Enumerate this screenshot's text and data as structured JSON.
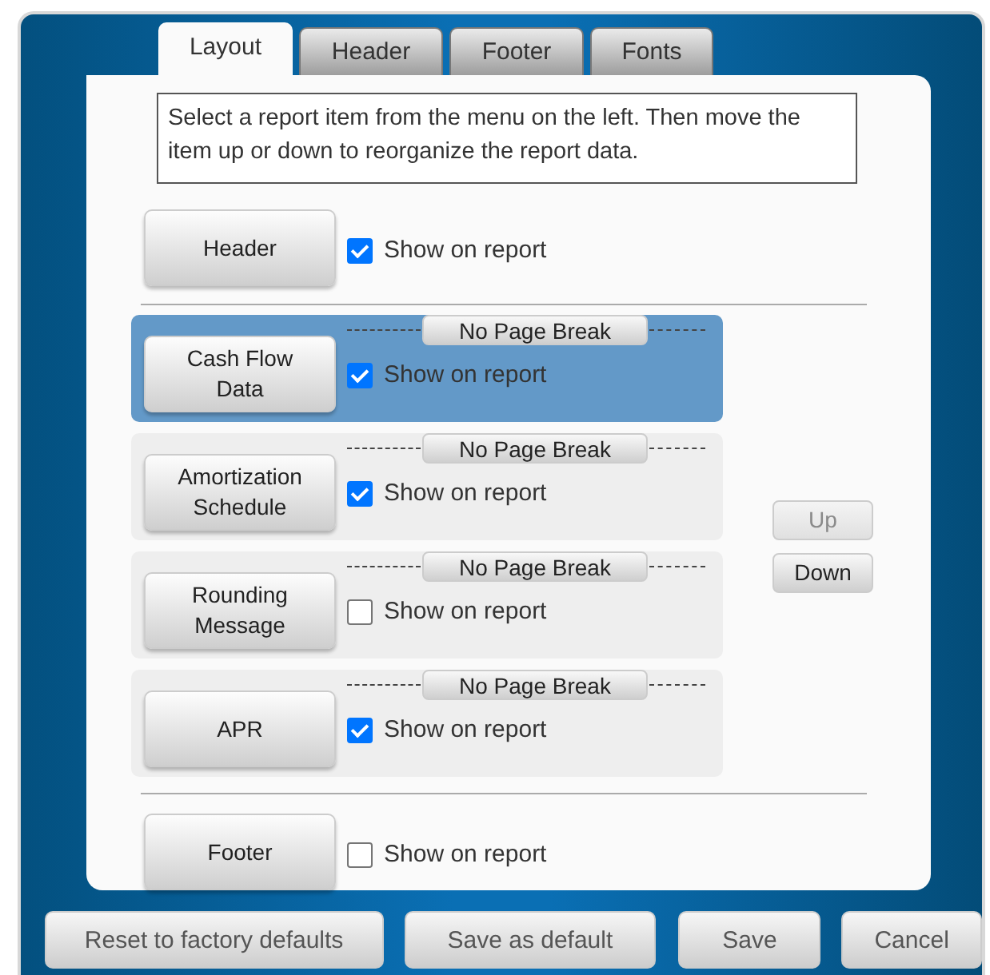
{
  "tabs": [
    {
      "label": "Layout",
      "selected": true
    },
    {
      "label": "Header",
      "selected": false
    },
    {
      "label": "Footer",
      "selected": false
    },
    {
      "label": "Fonts",
      "selected": false
    }
  ],
  "instructions": "Select a report item from the menu on the left. Then move the item up or down to reorganize the report data.",
  "header_section": {
    "label": "Header",
    "show_label": "Show on report",
    "checked": true
  },
  "items": [
    {
      "label": "Cash Flow Data",
      "selected": true,
      "checked": true,
      "show_label": "Show on report",
      "page_break": "No Page Break"
    },
    {
      "label": "Amortization Schedule",
      "selected": false,
      "checked": true,
      "show_label": "Show on report",
      "page_break": "No Page Break"
    },
    {
      "label": "Rounding Message",
      "selected": false,
      "checked": false,
      "show_label": "Show on report",
      "page_break": "No Page Break"
    },
    {
      "label": "APR",
      "selected": false,
      "checked": true,
      "show_label": "Show on report",
      "page_break": "No Page Break"
    }
  ],
  "move_buttons": [
    {
      "label": "Up",
      "disabled": true
    },
    {
      "label": "Down",
      "disabled": false
    }
  ],
  "footer_section": {
    "label": "Footer",
    "show_label": "Show on report",
    "checked": false
  },
  "buttons": [
    "Reset to factory defaults",
    "Save as default",
    "Save",
    "Cancel"
  ]
}
